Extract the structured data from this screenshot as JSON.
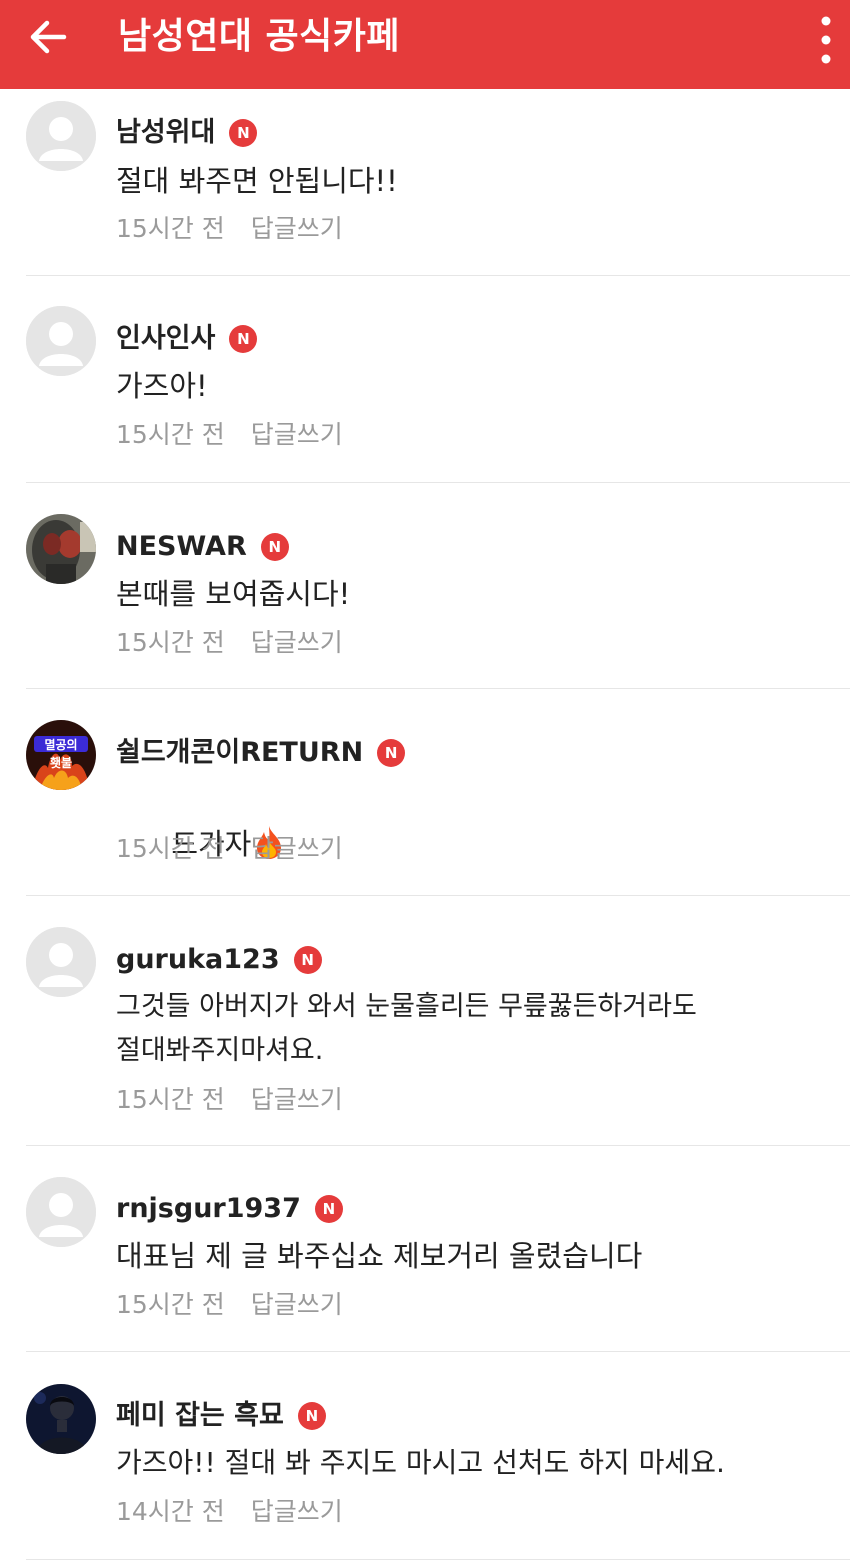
{
  "header": {
    "title": "남성연대 공식카페"
  },
  "badge_label": "N",
  "theme": {
    "accent": "#e53b3b",
    "muted_text": "#9a9a9a",
    "divider": "#e6e6e6"
  },
  "comments": [
    {
      "author": "남성위대",
      "text": "절대 봐주면 안됩니다!!",
      "time": "15시간 전",
      "reply_label": "답글쓰기",
      "avatar": "default-avatar"
    },
    {
      "author": "인사인사",
      "text": "가즈아!",
      "time": "15시간 전",
      "reply_label": "답글쓰기",
      "avatar": "default-avatar"
    },
    {
      "author": "NESWAR",
      "text": "본때를 보여줍시다!",
      "time": "15시간 전",
      "reply_label": "답글쓰기",
      "avatar": "photo-avatar"
    },
    {
      "author": "쉴드개콘이RETURN",
      "text": "드가자",
      "time": "15시간 전",
      "reply_label": "답글쓰기",
      "avatar": "avatar-image-text",
      "avatar_text": "멸공의 횃불",
      "emoji": "fire-emoji"
    },
    {
      "author": "guruka123",
      "text": "그것들 아버지가 와서 눈물흘리든 무릎꿇든하거라도\n절대봐주지마셔요.",
      "time": "15시간 전",
      "reply_label": "답글쓰기",
      "avatar": "default-avatar"
    },
    {
      "author": "rnjsgur1937",
      "text": "대표님 제 글 봐주십쇼 제보거리 올렸습니다",
      "time": "15시간 전",
      "reply_label": "답글쓰기",
      "avatar": "default-avatar"
    },
    {
      "author": "페미 잡는 흑묘",
      "text": "가즈아!! 절대 봐 주지도 마시고 선처도 하지 마세요.",
      "time": "14시간 전",
      "reply_label": "답글쓰기",
      "avatar": "photo-avatar"
    }
  ]
}
